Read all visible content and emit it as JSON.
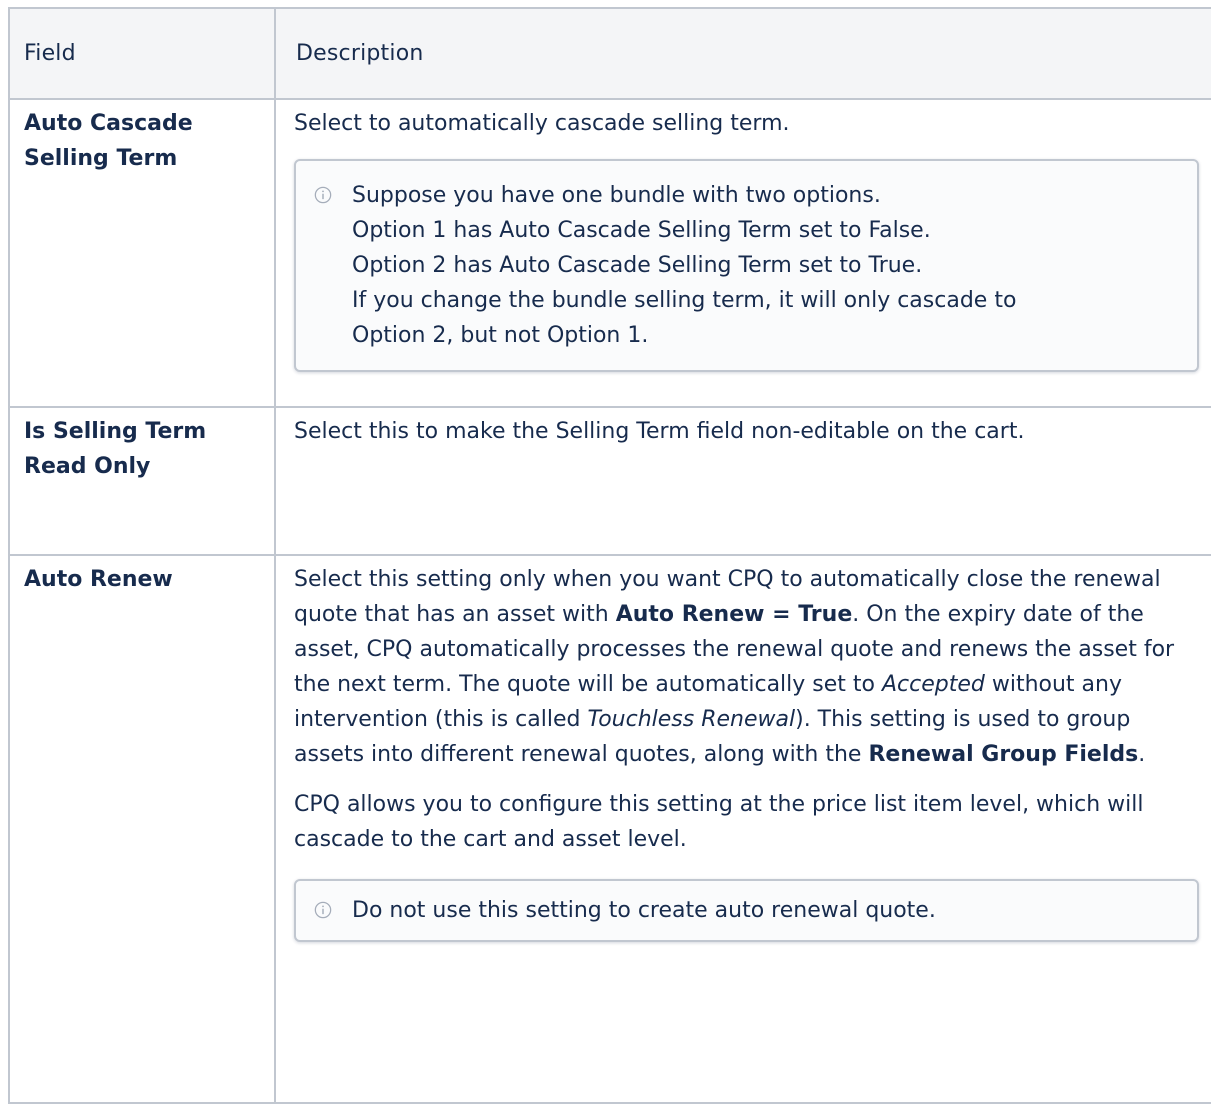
{
  "table": {
    "headers": {
      "field": "Field",
      "description": "Description"
    },
    "rows": [
      {
        "field_lines": [
          "Auto Cascade",
          "Selling Term"
        ],
        "description": "Select to automatically cascade selling term.",
        "note_lines": [
          "Suppose you have one bundle with two options.",
          "Option 1 has Auto Cascade Selling Term set to False.",
          "Option 2 has Auto Cascade Selling Term set to True.",
          "If you change the bundle selling term, it will only cascade to",
          "Option 2, but not Option 1."
        ]
      },
      {
        "field_lines": [
          "Is Selling Term",
          "Read Only"
        ],
        "description": "Select this to make the Selling Term field non-editable on the cart."
      },
      {
        "field_lines": [
          "Auto Renew"
        ],
        "para1": {
          "t1": "Select this setting only when you want CPQ to automatically close the renewal quote that has an asset with ",
          "b1": "Auto Renew = True",
          "t2": ". On the expiry date of the asset, CPQ automatically processes the renewal quote and renews the asset for the next term. The quote will be automatically set to ",
          "i1": "Accepted",
          "t3": " without any intervention (this is called ",
          "i2": "Touchless Renewal",
          "t4": "). This setting is used to group assets into different renewal quotes, along with the ",
          "b2": "Renewal Group Fields",
          "t5": "."
        },
        "para2": "CPQ allows you to configure this setting at the price list item level, which will cascade to the cart and asset level.",
        "note": "Do not use this setting to create auto renewal quote."
      }
    ]
  },
  "icons": {
    "note_icon": "info-circle-icon",
    "note_icon_color": "#a5adba"
  }
}
